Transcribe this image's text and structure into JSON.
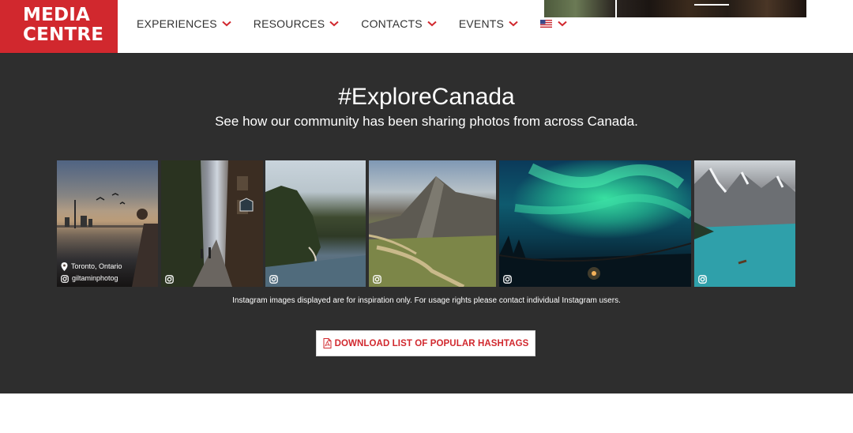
{
  "header": {
    "logo_line1": "MEDIA",
    "logo_line2": "CENTRE",
    "nav": [
      {
        "label": "EXPERIENCES"
      },
      {
        "label": "RESOURCES"
      },
      {
        "label": "CONTACTS"
      },
      {
        "label": "EVENTS"
      }
    ],
    "language_icon": "us-flag-icon"
  },
  "explore": {
    "title": "#ExploreCanada",
    "subtitle": "See how our community has been sharing photos from across Canada.",
    "photos": [
      {
        "location": "Toronto, Ontario",
        "user": "giltaminphotog",
        "icon": "instagram-icon"
      },
      {
        "icon": "instagram-icon"
      },
      {
        "icon": "instagram-icon"
      },
      {
        "icon": "instagram-icon"
      },
      {
        "icon": "instagram-icon"
      },
      {
        "icon": "instagram-icon"
      }
    ],
    "disclaimer": "Instagram images displayed are for inspiration only. For usage rights please contact individual Instagram users.",
    "download_label": "DOWNLOAD LIST OF POPULAR HASHTAGS"
  },
  "colors": {
    "brand_red": "#d1282e",
    "section_bg": "#2e2e2e"
  }
}
